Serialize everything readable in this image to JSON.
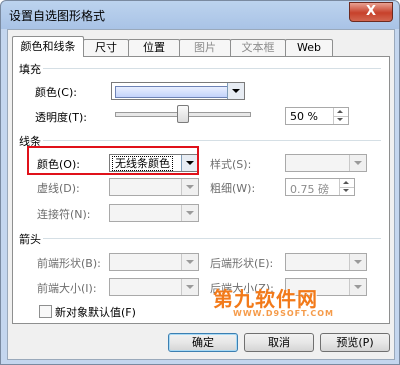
{
  "window": {
    "title": "设置自选图形格式",
    "close_label": "X"
  },
  "tabs": [
    {
      "label": "颜色和线条",
      "state": "active"
    },
    {
      "label": "尺寸",
      "state": "normal"
    },
    {
      "label": "位置",
      "state": "normal"
    },
    {
      "label": "图片",
      "state": "disabled"
    },
    {
      "label": "文本框",
      "state": "disabled"
    },
    {
      "label": "Web",
      "state": "normal"
    }
  ],
  "fill": {
    "group_title": "填充",
    "color_label": "颜色(C):",
    "transparency_label": "透明度(T):",
    "transparency_value": "50 %",
    "transparency_fraction": 0.5
  },
  "line": {
    "group_title": "线条",
    "color_label": "颜色(O):",
    "color_value": "无线条颜色",
    "dash_label": "虚线(D):",
    "connector_label": "连接符(N):",
    "style_label": "样式(S):",
    "weight_label": "粗细(W):",
    "weight_value": "0.75 磅"
  },
  "arrows": {
    "group_title": "箭头",
    "begin_style_label": "前端形状(B):",
    "begin_size_label": "前端大小(I):",
    "end_style_label": "后端形状(E):",
    "end_size_label": "后端大小(Z):"
  },
  "default_checkbox_label": "新对象默认值(F)",
  "buttons": {
    "ok": "确定",
    "cancel": "取消",
    "preview": "预览(P)"
  },
  "watermark": {
    "title": "第九软件网",
    "url": "WWW.D9SOFT.COM"
  },
  "colors": {
    "highlight": "#e0111a",
    "watermark": "#f27a1a"
  }
}
